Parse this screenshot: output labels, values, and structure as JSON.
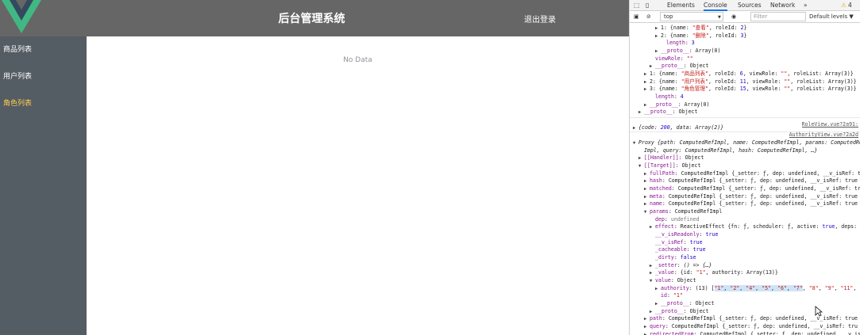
{
  "app": {
    "title": "后台管理系统",
    "logout": "退出登录",
    "sidebar": [
      {
        "label": "商品列表",
        "active": false
      },
      {
        "label": "用户列表",
        "active": false
      },
      {
        "label": "角色列表",
        "active": true
      }
    ],
    "empty_text": "No Data",
    "colors": {
      "header": "#666666",
      "sidebar": "#545c64",
      "active": "#ffd04b"
    }
  },
  "devtools": {
    "tabs": [
      "Elements",
      "Console",
      "Sources",
      "Network",
      "»"
    ],
    "active_tab": "Console",
    "warning_count": "4",
    "context": "top",
    "filter_placeholder": "Filter",
    "levels": "Default levels ▼",
    "source_role": "RoleView.vue?2a91:",
    "source_auth": "AuthorityView.vue?2a2d",
    "lines": [
      {
        "ind": 4,
        "tri": "▶",
        "html": "1: {name: <s>\"查看\"</s>, roleId: <n>2</n>}"
      },
      {
        "ind": 4,
        "tri": "▶",
        "html": "2: {name: <s>\"删除\"</s>, roleId: <n>3</n>}"
      },
      {
        "ind": 5,
        "tri": "",
        "html": "<k>length</k>: <n>3</n>"
      },
      {
        "ind": 4,
        "tri": "▶",
        "html": "<k>__proto__</k>: Array(0)"
      },
      {
        "ind": 3,
        "tri": "",
        "html": "<k>viewRole</k>: <s>\"\"</s>"
      },
      {
        "ind": 3,
        "tri": "▶",
        "html": "<k>__proto__</k>: Object"
      },
      {
        "ind": 2,
        "tri": "▶",
        "html": "1: {name: <s>\"商品列表\"</s>, roleId: <n>6</n>, viewRole: <s>\"\"</s>, roleList: Array(3)}"
      },
      {
        "ind": 2,
        "tri": "▶",
        "html": "2: {name: <s>\"用户列表\"</s>, roleId: <n>11</n>, viewRole: <s>\"\"</s>, roleList: Array(3)}"
      },
      {
        "ind": 2,
        "tri": "▶",
        "html": "3: {name: <s>\"角色管理\"</s>, roleId: <n>15</n>, viewRole: <s>\"\"</s>, roleList: Array(3)}"
      },
      {
        "ind": 3,
        "tri": "",
        "html": "<k>length</k>: <n>4</n>"
      },
      {
        "ind": 2,
        "tri": "▶",
        "html": "<k>__proto__</k>: Array(0)"
      },
      {
        "ind": 1,
        "tri": "▶",
        "html": "<k>__proto__</k>: Object"
      },
      {
        "ind": 0,
        "tri": "",
        "html": ""
      },
      {
        "ind": 0,
        "tri": "▶",
        "html": "<i>{code: <n>200</n>, data: Array(2)}</i>"
      },
      {
        "ind": 0,
        "tri": "",
        "html": ""
      },
      {
        "ind": 0,
        "tri": "▼",
        "html": "<i>Proxy {path: ComputedRefImpl, name: ComputedRefImpl, params: ComputedRefImpl</i>"
      },
      {
        "ind": 1,
        "tri": "",
        "html": "<i>Impl, query: ComputedRefImpl, hash: ComputedRefImpl, …}</i>"
      },
      {
        "ind": 1,
        "tri": "▶",
        "html": "<k>[[Handler]]</k>: Object"
      },
      {
        "ind": 1,
        "tri": "▼",
        "html": "<k>[[Target]]</k>: Object"
      },
      {
        "ind": 2,
        "tri": "▶",
        "html": "<k>fullPath</k>: ComputedRefImpl {_setter: ƒ, dep: undefined, __v_isRef: true"
      },
      {
        "ind": 2,
        "tri": "▶",
        "html": "<k>hash</k>: ComputedRefImpl {_setter: ƒ, dep: undefined, __v_isRef: true"
      },
      {
        "ind": 2,
        "tri": "▶",
        "html": "<k>matched</k>: ComputedRefImpl {_setter: ƒ, dep: undefined, __v_isRef: true"
      },
      {
        "ind": 2,
        "tri": "▶",
        "html": "<k>meta</k>: ComputedRefImpl {_setter: ƒ, dep: undefined, __v_isRef: true"
      },
      {
        "ind": 2,
        "tri": "▶",
        "html": "<k>name</k>: ComputedRefImpl {_setter: ƒ, dep: undefined, __v_isRef: true"
      },
      {
        "ind": 2,
        "tri": "▼",
        "html": "<k>params</k>: ComputedRefImpl"
      },
      {
        "ind": 3,
        "tri": "",
        "html": "<k>dep</k>: <g>undefined</g>"
      },
      {
        "ind": 3,
        "tri": "▶",
        "html": "<k>effect</k>: ReactiveEffect {fn: ƒ, scheduler: ƒ, active: <n>true</n>, deps: Arr"
      },
      {
        "ind": 3,
        "tri": "",
        "html": "<k>__v_isReadonly</k>: <n>true</n>"
      },
      {
        "ind": 3,
        "tri": "",
        "html": "<k>__v_isRef</k>: <n>true</n>"
      },
      {
        "ind": 3,
        "tri": "",
        "html": "<k>_cacheable</k>: <n>true</n>"
      },
      {
        "ind": 3,
        "tri": "",
        "html": "<k>_dirty</k>: <n>false</n>"
      },
      {
        "ind": 3,
        "tri": "▶",
        "html": "<k>_setter</k>: <i>() => {…}</i>"
      },
      {
        "ind": 3,
        "tri": "▶",
        "html": "<k>_value</k>: {id: <s>\"1\"</s>, authority: Array(13)}"
      },
      {
        "ind": 3,
        "tri": "▼",
        "html": "<k>value</k>: Object"
      },
      {
        "ind": 4,
        "tri": "▶",
        "html": "<k>authority</k>: (13) [<hl><s>\"1\"</s>, <s>\"2\"</s>, <s>\"4\"</s>, <s>\"5\"</s>, <s>\"6\"</s>, <s>\"7\"</s></hl>, <s>\"8\"</s>, <s>\"9\"</s>, <s>\"11\"</s>, <s>\"1</s>"
      },
      {
        "ind": 4,
        "tri": "",
        "html": "<k>id</k>: <s>\"1\"</s>"
      },
      {
        "ind": 4,
        "tri": "▶",
        "html": "<k>__proto__</k>: Object"
      },
      {
        "ind": 3,
        "tri": "▶",
        "html": "<k>__proto__</k>: Object"
      },
      {
        "ind": 2,
        "tri": "▶",
        "html": "<k>path</k>: ComputedRefImpl {_setter: ƒ, dep: undefined, __v_isRef: true"
      },
      {
        "ind": 2,
        "tri": "▶",
        "html": "<k>query</k>: ComputedRefImpl {_setter: ƒ, dep: undefined, __v_isRef: tru"
      },
      {
        "ind": 2,
        "tri": "▶",
        "html": "<k>redirectedFrom</k>: ComputedRefImpl {_setter: ƒ, dep: undefined, __v_is"
      }
    ]
  }
}
